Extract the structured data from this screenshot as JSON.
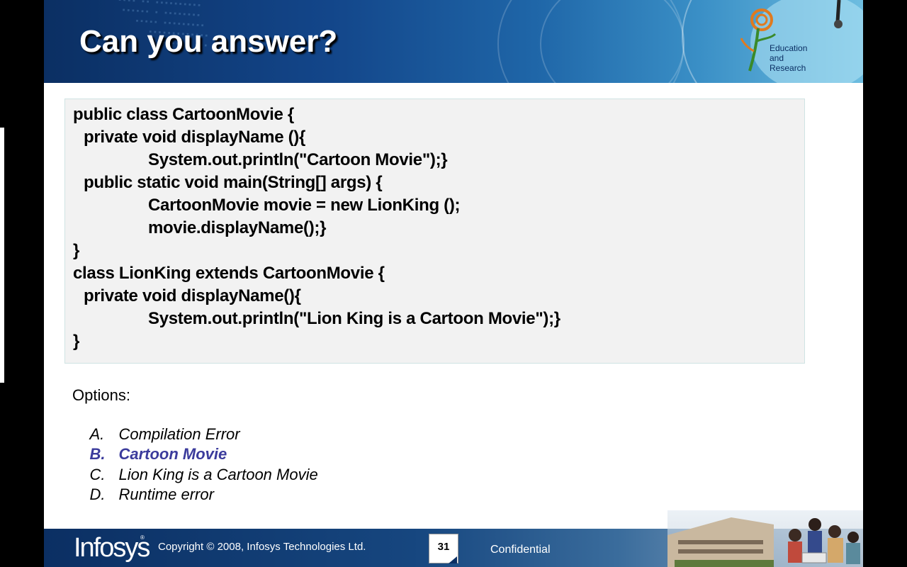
{
  "header": {
    "title": "Can you answer?",
    "logo_text": [
      "Education",
      "and",
      "Research"
    ]
  },
  "code": {
    "lines": [
      "public class CartoonMovie {",
      "private void displayName (){",
      "System.out.println(\"Cartoon Movie\");}",
      "public static void main(String[] args) {",
      "CartoonMovie movie = new LionKing ();",
      "movie.displayName();}",
      "}",
      "class LionKing extends CartoonMovie {",
      "private void displayName(){",
      "System.out.println(\"Lion King is a Cartoon Movie\");}",
      "}"
    ]
  },
  "options": {
    "label": "Options:",
    "items": [
      {
        "letter": "A.",
        "text": "Compilation Error"
      },
      {
        "letter": "B.",
        "text": "Cartoon Movie"
      },
      {
        "letter": "C.",
        "text": "Lion King is a Cartoon Movie"
      },
      {
        "letter": "D.",
        "text": "Runtime error"
      }
    ],
    "highlight_color": "#3b3b9c"
  },
  "footer": {
    "brand": "Infosys",
    "brand_mark": "®",
    "copyright": "Copyright © 2008, Infosys  Technologies  Ltd.",
    "page_number": "31",
    "confidential": "Confidential"
  },
  "colors": {
    "header_dark": "#0b2f63",
    "code_bg": "#f2f2f2"
  }
}
